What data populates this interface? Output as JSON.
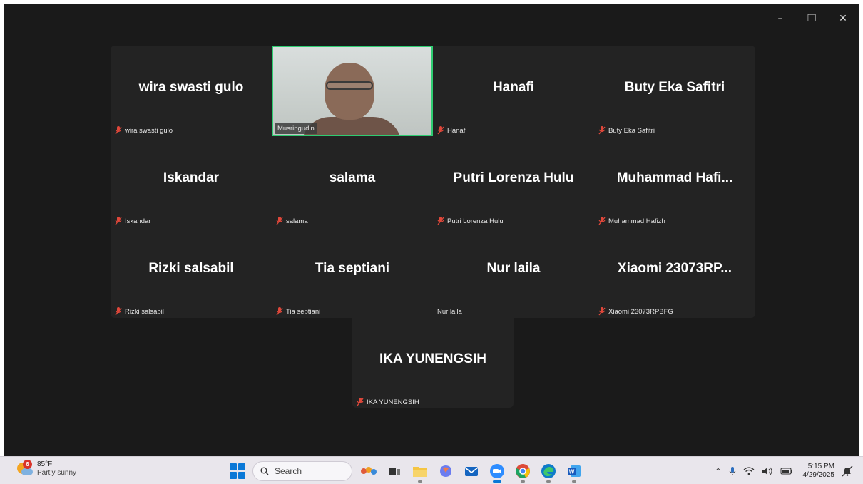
{
  "window": {
    "controls": {
      "minimize": "–",
      "restore": "❐",
      "close": "✕"
    }
  },
  "participants": [
    {
      "name": "wira swasti gulo",
      "label": "wira swasti gulo",
      "muted": true
    },
    {
      "name": "Musringudin",
      "label": "Musringudin",
      "video": true
    },
    {
      "name": "Hanafi",
      "label": "Hanafi",
      "muted": true
    },
    {
      "name": "Buty Eka Safitri",
      "label": "Buty Eka Safitri",
      "muted": true
    },
    {
      "name": "Iskandar",
      "label": "Iskandar",
      "muted": true
    },
    {
      "name": "salama",
      "label": "salama",
      "muted": true
    },
    {
      "name": "Putri Lorenza Hulu",
      "label": "Putri Lorenza Hulu",
      "muted": true
    },
    {
      "name": "Muhammad Hafi...",
      "label": "Muhammad Hafizh",
      "muted": true
    },
    {
      "name": "Rizki salsabil",
      "label": "Rizki salsabil",
      "muted": true
    },
    {
      "name": "Tia septiani",
      "label": "Tia septiani",
      "muted": true
    },
    {
      "name": "Nur laila",
      "label": "Nur laila",
      "muted": false
    },
    {
      "name": "Xiaomi 23073RP...",
      "label": "Xiaomi 23073RPBFG",
      "muted": true
    },
    {
      "name": "IKA YUNENGSIH",
      "label": "IKA YUNENGSIH",
      "muted": true
    }
  ],
  "taskbar": {
    "weather": {
      "temp": "85°F",
      "desc": "Partly sunny",
      "badge": "6"
    },
    "search_placeholder": "Search",
    "apps": [
      "widgets-app",
      "file-explorer",
      "folder",
      "copilot",
      "mail",
      "zoom",
      "chrome",
      "edge",
      "word"
    ],
    "tray": {
      "chevron": "^",
      "clock_time": "5:15 PM",
      "clock_date": "4/29/2025"
    }
  },
  "colors": {
    "background": "#1a1a1a",
    "tile": "#232323",
    "active_speaker_border": "#2ecc71",
    "mic_off": "#e0473a"
  }
}
